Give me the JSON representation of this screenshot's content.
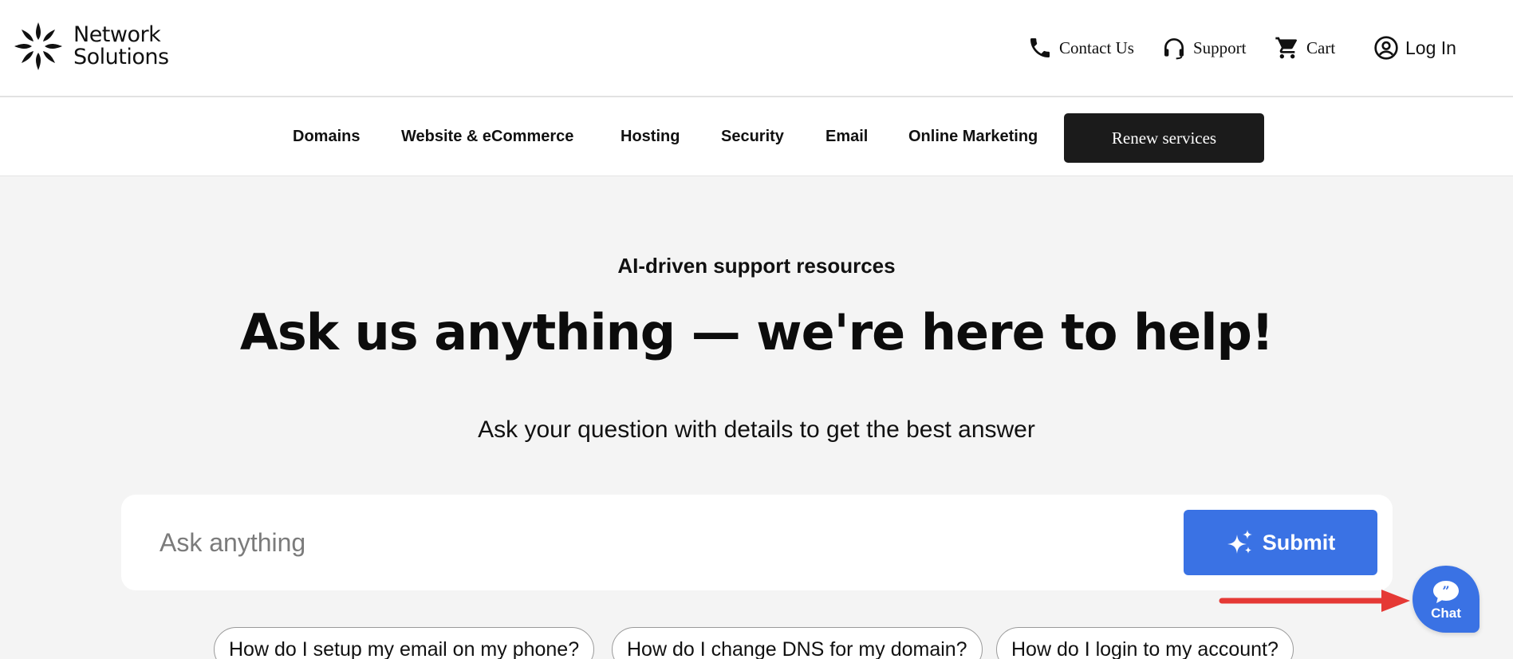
{
  "header": {
    "logo_line1": "Network",
    "logo_line2": "Solutions",
    "util": {
      "contact": "Contact Us",
      "support": "Support",
      "cart": "Cart",
      "login": "Log In"
    }
  },
  "nav": {
    "items": [
      "Domains",
      "Website & eCommerce",
      "Hosting",
      "Security",
      "Email",
      "Online Marketing"
    ],
    "renew": "Renew services"
  },
  "hero": {
    "eyebrow": "AI-driven support resources",
    "title": "Ask us anything — we're here to help!",
    "subtitle": "Ask your question with details to get the best answer"
  },
  "ask": {
    "placeholder": "Ask anything",
    "value": "",
    "submit": "Submit"
  },
  "suggestions": [
    "How do I setup my email on my phone?",
    "How do I change DNS for my domain?",
    "How do I login to my account?"
  ],
  "chat": {
    "label": "Chat"
  },
  "colors": {
    "accent": "#3a72e4",
    "dark_button": "#1b1b1b",
    "background": "#f4f4f4",
    "arrow": "#e53935"
  },
  "icons": {
    "logo": "network-solutions-logo-icon",
    "contact": "phone-icon",
    "support": "headset-icon",
    "cart": "cart-icon",
    "login": "user-circle-icon",
    "submit": "sparkle-icon",
    "chat": "chat-bubble-icon"
  }
}
